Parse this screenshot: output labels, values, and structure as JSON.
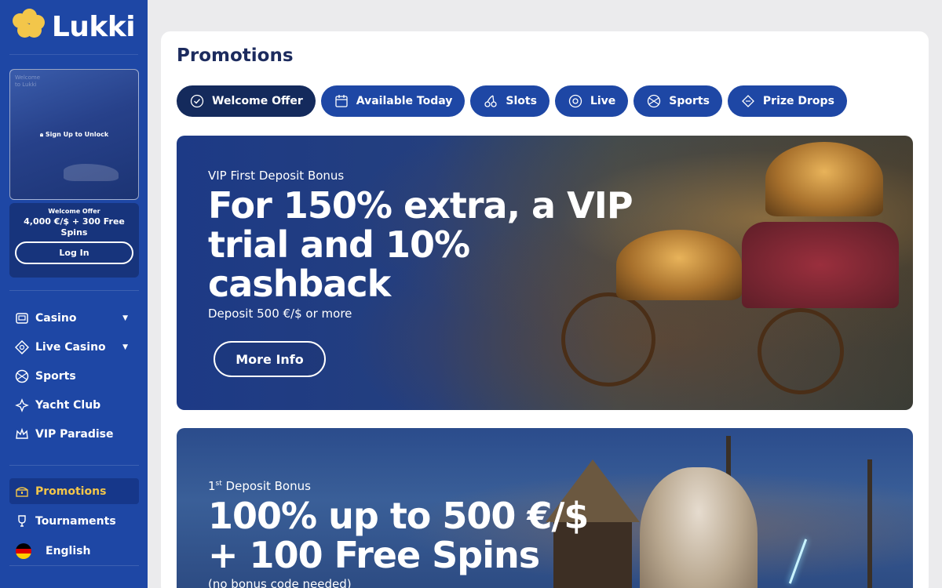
{
  "brand": {
    "name": "Lukki",
    "accent": "#1e47a5",
    "gold": "#f3c64a",
    "dark": "#142a5c"
  },
  "sidebar": {
    "promo_card": {
      "welcome_text": "Welcome to Lukki",
      "unlock_label": "Sign Up to Unlock"
    },
    "welcome_box": {
      "label": "Welcome Offer",
      "amount": "4,000 €/$ + 300 Free Spins",
      "login_label": "Log In"
    },
    "nav_main": [
      {
        "label": "Casino",
        "icon": "casino-icon",
        "has_dropdown": true
      },
      {
        "label": "Live Casino",
        "icon": "live-casino-icon",
        "has_dropdown": true
      },
      {
        "label": "Sports",
        "icon": "sports-ball-icon",
        "has_dropdown": false
      },
      {
        "label": "Yacht Club",
        "icon": "yacht-club-icon",
        "has_dropdown": false
      },
      {
        "label": "VIP Paradise",
        "icon": "crown-icon",
        "has_dropdown": false
      }
    ],
    "nav_secondary": [
      {
        "label": "Promotions",
        "icon": "treasure-chest-icon",
        "active": true
      },
      {
        "label": "Tournaments",
        "icon": "trophy-icon",
        "active": false
      }
    ],
    "language": {
      "label": "English",
      "icon": "german-flag-icon"
    }
  },
  "main": {
    "title": "Promotions",
    "tabs": [
      {
        "label": "Welcome Offer",
        "icon": "check-badge-icon",
        "active": true
      },
      {
        "label": "Available Today",
        "icon": "calendar-icon",
        "active": false
      },
      {
        "label": "Slots",
        "icon": "cherries-icon",
        "active": false
      },
      {
        "label": "Live",
        "icon": "live-chip-icon",
        "active": false
      },
      {
        "label": "Sports",
        "icon": "sports-ball-icon",
        "active": false
      },
      {
        "label": "Prize Drops",
        "icon": "ticket-icon",
        "active": false
      }
    ],
    "banner1": {
      "subtitle": "VIP First Deposit Bonus",
      "headline_1": "For 150% extra, a VIP",
      "headline_2": "trial and 10%",
      "headline_3": "cashback",
      "description": "Deposit 500 €/$ or more",
      "button_label": "More Info"
    },
    "banner2": {
      "subtitle_num": "1",
      "subtitle_sup": "st",
      "subtitle_rest": " Deposit Bonus",
      "headline_1": "100% up to 500 €/$",
      "headline_2": "+ 100 Free Spins",
      "description": "(no bonus code needed)"
    }
  }
}
